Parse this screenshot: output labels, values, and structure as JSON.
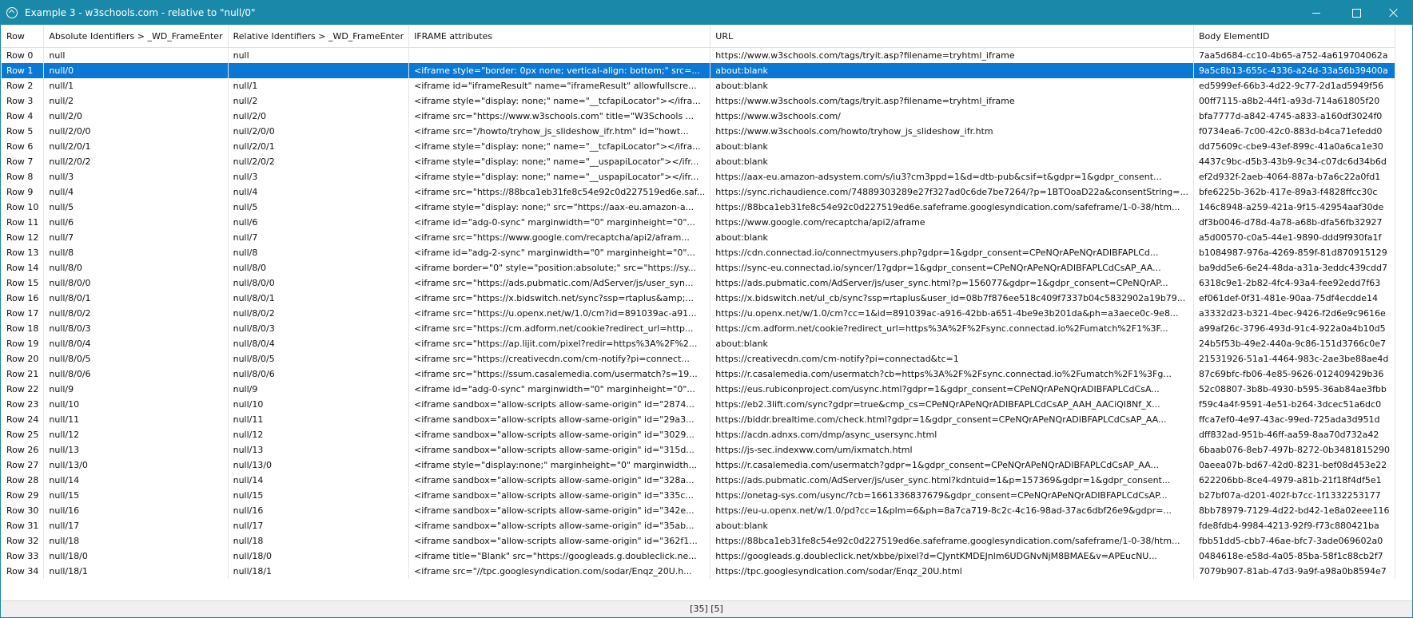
{
  "window": {
    "title": "Example 3 - w3schools.com - relative to \"null/0\"",
    "title_color": "#1a88a8"
  },
  "grid": {
    "columns": [
      "Row",
      "Absolute Identifiers > _WD_FrameEnter",
      "Relative Identifiers > _WD_FrameEnter",
      "IFRAME attributes",
      "URL",
      "Body ElementID"
    ],
    "selected_row": 1,
    "selected_color": "#0a78d4",
    "rows": [
      [
        "Row 0",
        "null",
        "null",
        "",
        "https://www.w3schools.com/tags/tryit.asp?filename=tryhtml_iframe",
        "7aa5d684-cc10-4b65-a752-4a619704062a"
      ],
      [
        "Row 1",
        "null/0",
        "",
        "<iframe style=\"border: 0px none; vertical-align: bottom;\" src=...",
        "about:blank",
        "9a5c8b13-655c-4336-a24d-33a56b39400a"
      ],
      [
        "Row 2",
        "null/1",
        "null/1",
        "<iframe id=\"iframeResult\" name=\"iframeResult\" allowfullscre...",
        "about:blank",
        "ed5999ef-66b3-4d22-9c77-2d1ad5949f56"
      ],
      [
        "Row 3",
        "null/2",
        "null/2",
        "<iframe style=\"display: none;\" name=\"__tcfapiLocator\"></ifra...",
        "https://www.w3schools.com/tags/tryit.asp?filename=tryhtml_iframe",
        "00ff7115-a8b2-44f1-a93d-714a61805f20"
      ],
      [
        "Row 4",
        "null/2/0",
        "null/2/0",
        "<iframe src=\"https://www.w3schools.com\" title=\"W3Schools ...",
        "https://www.w3schools.com/",
        "bfa7777d-a842-4745-a833-a160df3024f0"
      ],
      [
        "Row 5",
        "null/2/0/0",
        "null/2/0/0",
        "<iframe src=\"/howto/tryhow_js_slideshow_ifr.htm\" id=\"howt...",
        "https://www.w3schools.com/howto/tryhow_js_slideshow_ifr.htm",
        "f0734ea6-7c00-42c0-883d-b4ca71efedd0"
      ],
      [
        "Row 6",
        "null/2/0/1",
        "null/2/0/1",
        "<iframe style=\"display: none;\" name=\"__tcfapiLocator\"></ifra...",
        "about:blank",
        "dd75609c-cbe9-43ef-899c-41a0a6ca1e30"
      ],
      [
        "Row 7",
        "null/2/0/2",
        "null/2/0/2",
        "<iframe style=\"display: none;\" name=\"__uspapiLocator\"></ifr...",
        "about:blank",
        "4437c9bc-d5b3-43b9-9c34-c07dc6d34b6d"
      ],
      [
        "Row 8",
        "null/3",
        "null/3",
        "<iframe style=\"display: none;\" name=\"__uspapiLocator\"></ifr...",
        "https://aax-eu.amazon-adsystem.com/s/iu3?cm3ppd=1&d=dtb-pub&csif=t&gdpr=1&gdpr_consent...",
        "ef2d932f-2aeb-4064-887a-b7a6c22a0fd1"
      ],
      [
        "Row 9",
        "null/4",
        "null/4",
        "<iframe src=\"https://88bca1eb31fe8c54e92c0d227519ed6e.saf...",
        "https://sync.richaudience.com/74889303289e27f327ad0c6de7be7264/?p=1BTOoaD22a&consentString=...",
        "bfe6225b-362b-417e-89a3-f4828ffcc30c"
      ],
      [
        "Row 10",
        "null/5",
        "null/5",
        "<iframe style=\"display: none;\" src=\"https://aax-eu.amazon-a...",
        "https://88bca1eb31fe8c54e92c0d227519ed6e.safeframe.googlesyndication.com/safeframe/1-0-38/htm...",
        "146c8948-a259-421a-9f15-42954aaf30de"
      ],
      [
        "Row 11",
        "null/6",
        "null/6",
        "<iframe id=\"adg-0-sync\" marginwidth=\"0\" marginheight=\"0\"...",
        "https://www.google.com/recaptcha/api2/aframe",
        "df3b0046-d78d-4a78-a68b-dfa56fb32927"
      ],
      [
        "Row 12",
        "null/7",
        "null/7",
        "<iframe src=\"https://www.google.com/recaptcha/api2/afram...",
        "about:blank",
        "a5d00570-c0a5-44e1-9890-ddd9f930fa1f"
      ],
      [
        "Row 13",
        "null/8",
        "null/8",
        "<iframe id=\"adg-2-sync\" marginwidth=\"0\" marginheight=\"0\"...",
        "https://cdn.connectad.io/connectmyusers.php?gdpr=1&gdpr_consent=CPeNQrAPeNQrADIBFAPLCd...",
        "b1084987-976a-4269-859f-81d870915129"
      ],
      [
        "Row 14",
        "null/8/0",
        "null/8/0",
        "<iframe border=\"0\" style=\"position:absolute;\" src=\"https://sy...",
        "https://sync-eu.connectad.io/syncer/1?gdpr=1&gdpr_consent=CPeNQrAPeNQrADIBFAPLCdCsAP_AA...",
        "ba9dd5e6-6e24-48da-a31a-3eddc439cdd7"
      ],
      [
        "Row 15",
        "null/8/0/0",
        "null/8/0/0",
        "<iframe src=\"https://ads.pubmatic.com/AdServer/js/user_syn...",
        "https://ads.pubmatic.com/AdServer/js/user_sync.html?p=156077&gdpr=1&gdpr_consent=CPeNQrAP...",
        "6318c9e1-2b82-4fc4-93a4-fee92edd7f63"
      ],
      [
        "Row 16",
        "null/8/0/1",
        "null/8/0/1",
        "<iframe src=\"https://x.bidswitch.net/sync?ssp=rtaplus&amp;...",
        "https://x.bidswitch.net/ul_cb/sync?ssp=rtaplus&user_id=08b7f876ee518c409f7337b04c5832902a19b79...",
        "ef061def-0f31-481e-90aa-75df4ecdde14"
      ],
      [
        "Row 17",
        "null/8/0/2",
        "null/8/0/2",
        "<iframe src=\"https://u.openx.net/w/1.0/cm?id=891039ac-a91...",
        "https://u.openx.net/w/1.0/cm?cc=1&id=891039ac-a916-42bb-a651-4be9e3b201da&ph=a3aece0c-9e8...",
        "a3332d23-b321-4bec-9426-f2d6e9c9616e"
      ],
      [
        "Row 18",
        "null/8/0/3",
        "null/8/0/3",
        "<iframe src=\"https://cm.adform.net/cookie?redirect_url=http...",
        "https://cm.adform.net/cookie?redirect_url=https%3A%2F%2Fsync.connectad.io%2Fumatch%2F1%3F...",
        "a99af26c-3796-493d-91c4-922a0a4b10d5"
      ],
      [
        "Row 19",
        "null/8/0/4",
        "null/8/0/4",
        "<iframe src=\"https://ap.lijit.com/pixel?redir=https%3A%2F%2...",
        "about:blank",
        "24b5f53b-49e2-440a-9c86-151d3766c0e7"
      ],
      [
        "Row 20",
        "null/8/0/5",
        "null/8/0/5",
        "<iframe src=\"https://creativecdn.com/cm-notify?pi=connect...",
        "https://creativecdn.com/cm-notify?pi=connectad&tc=1",
        "21531926-51a1-4464-983c-2ae3be88ae4d"
      ],
      [
        "Row 21",
        "null/8/0/6",
        "null/8/0/6",
        "<iframe src=\"https://ssum.casalemedia.com/usermatch?s=19...",
        "https://r.casalemedia.com/usermatch?cb=https%3A%2F%2Fsync.connectad.io%2Fumatch%2F1%3Fg...",
        "87c69bfc-fb06-4e85-9626-012409429b36"
      ],
      [
        "Row 22",
        "null/9",
        "null/9",
        "<iframe id=\"adg-0-sync\" marginwidth=\"0\" marginheight=\"0\"...",
        "https://eus.rubiconproject.com/usync.html?gdpr=1&gdpr_consent=CPeNQrAPeNQrADIBFAPLCdCsA...",
        "52c08807-3b8b-4930-b595-36ab84ae3fbb"
      ],
      [
        "Row 23",
        "null/10",
        "null/10",
        "<iframe sandbox=\"allow-scripts allow-same-origin\" id=\"2874...",
        "https://eb2.3lift.com/sync?gdpr=true&cmp_cs=CPeNQrAPeNQrADIBFAPLCdCsAP_AAH_AACiQI8Nf_X...",
        "f59c4a4f-9591-4e51-b264-3dcec51a6dc0"
      ],
      [
        "Row 24",
        "null/11",
        "null/11",
        "<iframe sandbox=\"allow-scripts allow-same-origin\" id=\"29a3...",
        "https://biddr.brealtime.com/check.html?gdpr=1&gdpr_consent=CPeNQrAPeNQrADIBFAPLCdCsAP_AA...",
        "ffca7ef0-4e97-43ac-99ed-725ada3d951d"
      ],
      [
        "Row 25",
        "null/12",
        "null/12",
        "<iframe sandbox=\"allow-scripts allow-same-origin\" id=\"3029...",
        "https://acdn.adnxs.com/dmp/async_usersync.html",
        "dff832ad-951b-46ff-aa59-8aa70d732a42"
      ],
      [
        "Row 26",
        "null/13",
        "null/13",
        "<iframe sandbox=\"allow-scripts allow-same-origin\" id=\"315d...",
        "https://js-sec.indexww.com/um/ixmatch.html",
        "6baab076-8eb7-497b-8272-0b3481815290"
      ],
      [
        "Row 27",
        "null/13/0",
        "null/13/0",
        "<iframe style=\"display:none;\" marginheight=\"0\" marginwidth...",
        "https://r.casalemedia.com/usermatch?gdpr=1&gdpr_consent=CPeNQrAPeNQrADIBFAPLCdCsAP_AA...",
        "0aeea07b-bd67-42d0-8231-bef08d453e22"
      ],
      [
        "Row 28",
        "null/14",
        "null/14",
        "<iframe sandbox=\"allow-scripts allow-same-origin\" id=\"328a...",
        "https://ads.pubmatic.com/AdServer/js/user_sync.html?kdntuid=1&p=157369&gdpr=1&gdpr_consent...",
        "622206bb-8ce4-4979-a81b-21f18f4df5e1"
      ],
      [
        "Row 29",
        "null/15",
        "null/15",
        "<iframe sandbox=\"allow-scripts allow-same-origin\" id=\"335c...",
        "https://onetag-sys.com/usync/?cb=1661336837679&gdpr_consent=CPeNQrAPeNQrADIBFAPLCdCsAP...",
        "b27bf07a-d201-402f-b7cc-1f1332253177"
      ],
      [
        "Row 30",
        "null/16",
        "null/16",
        "<iframe sandbox=\"allow-scripts allow-same-origin\" id=\"342e...",
        "https://eu-u.openx.net/w/1.0/pd?cc=1&plm=6&ph=8a7ca719-8c2c-4c16-98ad-37ac6dbf26e9&gdpr=...",
        "8bb78979-7129-4d22-bd42-1e8a02eee116"
      ],
      [
        "Row 31",
        "null/17",
        "null/17",
        "<iframe sandbox=\"allow-scripts allow-same-origin\" id=\"35ab...",
        "about:blank",
        "fde8fdb4-9984-4213-92f9-f73c880421ba"
      ],
      [
        "Row 32",
        "null/18",
        "null/18",
        "<iframe sandbox=\"allow-scripts allow-same-origin\" id=\"362f1...",
        "https://88bca1eb31fe8c54e92c0d227519ed6e.safeframe.googlesyndication.com/safeframe/1-0-38/htm...",
        "fbb51dd5-cbb7-46ae-bfc7-3ade069602a0"
      ],
      [
        "Row 33",
        "null/18/0",
        "null/18/0",
        "<iframe title=\"Blank\" src=\"https://googleads.g.doubleclick.ne...",
        "https://googleads.g.doubleclick.net/xbbe/pixel?d=CJyntKMDEJnlm6UDGNvNjM8BMAE&v=APEucNU...",
        "0484618e-e58d-4a05-85ba-58f1c88cb2f7"
      ],
      [
        "Row 34",
        "null/18/1",
        "null/18/1",
        "<iframe src=\"//tpc.googlesyndication.com/sodar/Enqz_20U.h...",
        "https://tpc.googlesyndication.com/sodar/Enqz_20U.html",
        "7079b907-81ab-47d3-9a9f-a98a0b8594e7"
      ]
    ]
  },
  "statusbar": {
    "text": "[35] [5]"
  }
}
